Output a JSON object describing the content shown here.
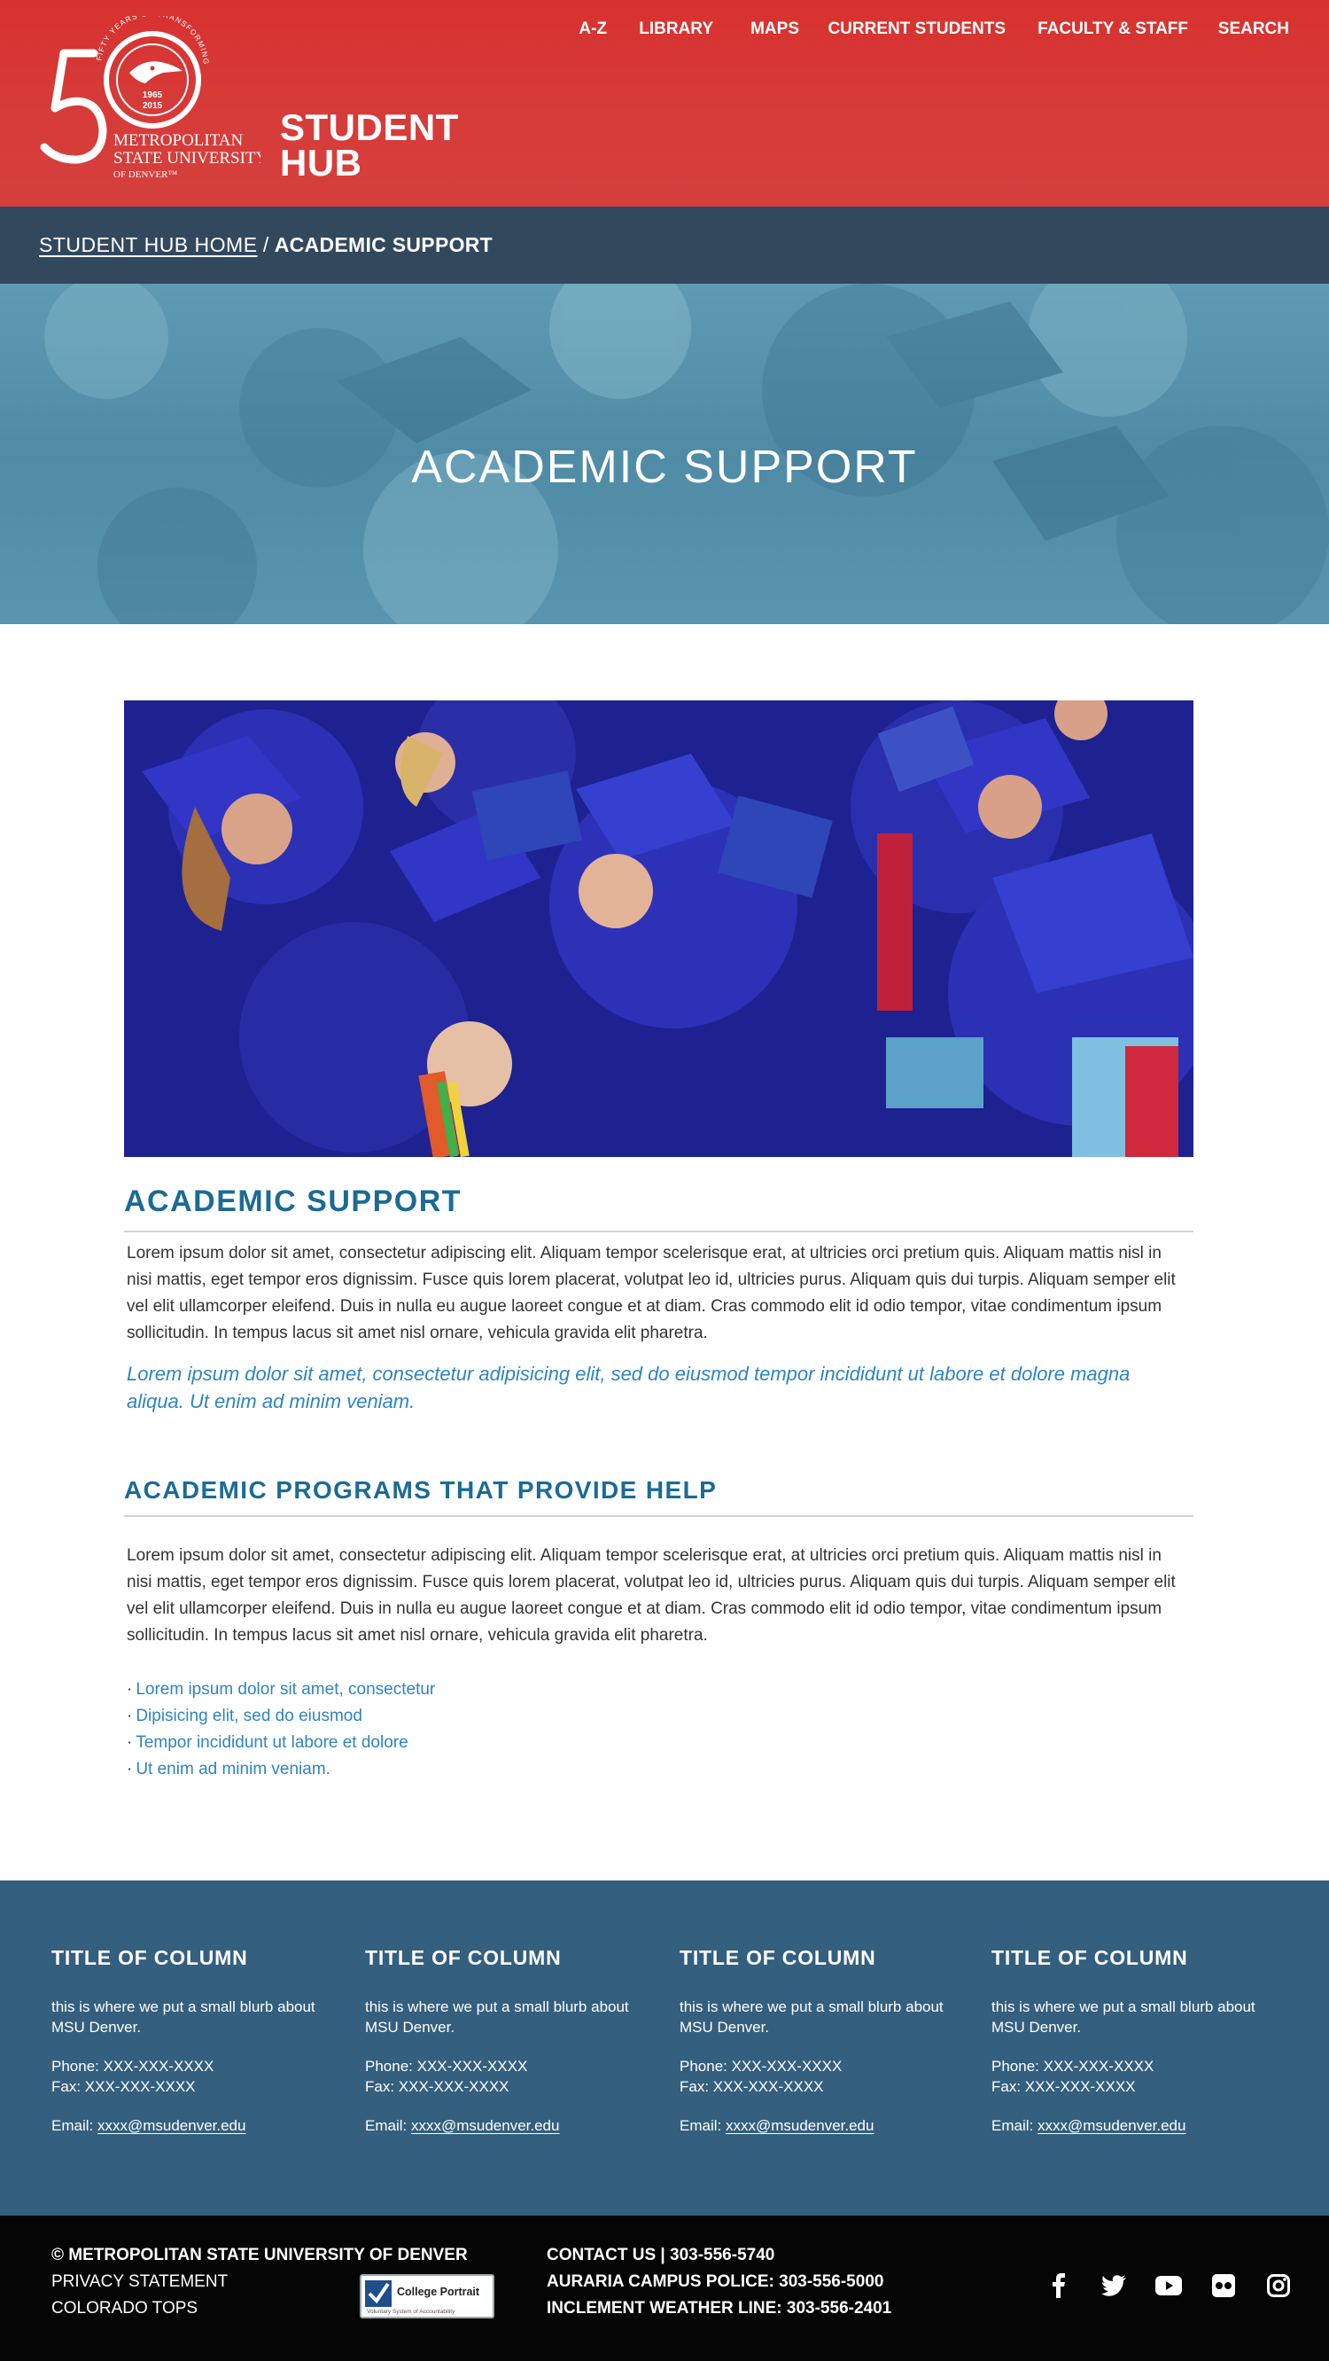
{
  "header": {
    "logo": {
      "numeral": "50",
      "ring_text": "FIFTY YEARS OF TRANSFORMING LIVES",
      "years_top": "1965",
      "years_bottom": "2015",
      "line1": "METROPOLITAN",
      "line2": "STATE UNIVERSITY",
      "line3": "OF DENVER™"
    },
    "hub_line1": "STUDENT",
    "hub_line2": "HUB",
    "nav": [
      "A-Z",
      "LIBRARY",
      "MAPS",
      "CURRENT STUDENTS",
      "FACULTY & STAFF",
      "SEARCH"
    ],
    "background_color": "#d7322f"
  },
  "breadcrumb": {
    "home": "STUDENT HUB HOME",
    "separator": " / ",
    "current": "ACADEMIC SUPPORT"
  },
  "hero": {
    "title": "ACADEMIC SUPPORT"
  },
  "main": {
    "section_title": "ACADEMIC SUPPORT",
    "paragraph1": "Lorem ipsum dolor sit amet, consectetur adipiscing elit. Aliquam tempor scelerisque erat, at ultricies orci pretium quis. Aliquam mattis nisl in nisi mattis, eget tempor eros dignissim. Fusce quis lorem placerat, volutpat leo id, ultricies purus. Aliquam quis dui turpis. Aliquam semper elit vel elit ullamcorper eleifend. Duis in nulla eu augue laoreet congue et at diam. Cras commodo elit id odio tempor, vitae condimentum ipsum sollicitudin. In tempus lacus sit amet nisl ornare, vehicula gravida elit pharetra.",
    "lead": "Lorem ipsum dolor sit amet, consectetur adipisicing elit, sed do eiusmod tempor incididunt ut labore et dolore magna aliqua. Ut enim ad minim veniam.",
    "programs_title": "ACADEMIC PROGRAMS THAT PROVIDE HELP",
    "paragraph2": "Lorem ipsum dolor sit amet, consectetur adipiscing elit. Aliquam tempor scelerisque erat, at ultricies orci pretium quis. Aliquam mattis nisl in nisi mattis, eget tempor eros dignissim. Fusce quis lorem placerat, volutpat leo id, ultricies purus. Aliquam quis dui turpis. Aliquam semper elit vel elit ullamcorper eleifend. Duis in nulla eu augue laoreet congue et at diam. Cras commodo elit id odio tempor, vitae condimentum ipsum sollicitudin. In tempus lacus sit amet nisl ornare, vehicula gravida elit pharetra.",
    "bullet_marker": "·",
    "links": [
      "Lorem ipsum dolor sit amet, consectetur",
      "Dipisicing elit, sed do eiusmod",
      "Tempor incididunt ut labore et dolore",
      "Ut enim ad minim veniam."
    ],
    "accent_color": "#1b6b96",
    "link_color": "#2e84c2"
  },
  "footer_columns": [
    {
      "title": "TITLE OF COLUMN",
      "blurb": "this is where we put a small blurb about MSU Denver.",
      "phone": "Phone: XXX-XXX-XXXX",
      "fax": "Fax: XXX-XXX-XXXX",
      "email_label": "Email: ",
      "email": "xxxx@msudenver.edu"
    },
    {
      "title": "TITLE OF COLUMN",
      "blurb": "this is where we put a small blurb about MSU Denver.",
      "phone": "Phone: XXX-XXX-XXXX",
      "fax": "Fax: XXX-XXX-XXXX",
      "email_label": "Email: ",
      "email": "xxxx@msudenver.edu"
    },
    {
      "title": "TITLE OF COLUMN",
      "blurb": "this is where we put a small blurb about MSU Denver.",
      "phone": "Phone: XXX-XXX-XXXX",
      "fax": "Fax: XXX-XXX-XXXX",
      "email_label": "Email: ",
      "email": "xxxx@msudenver.edu"
    },
    {
      "title": "TITLE OF COLUMN",
      "blurb": "this is where we put a small blurb about MSU Denver.",
      "phone": "Phone: XXX-XXX-XXXX",
      "fax": "Fax: XXX-XXX-XXXX",
      "email_label": "Email: ",
      "email": "xxxx@msudenver.edu"
    }
  ],
  "bottom_bar": {
    "copyright": "© METROPOLITAN STATE UNIVERSITY OF DENVER",
    "privacy": "PRIVACY STATEMENT",
    "tops": "COLORADO TOPS",
    "portrait_badge": {
      "title": "College Portrait",
      "subtitle": "Voluntary System of Accountability"
    },
    "contact": "CONTACT US | 303-556-5740",
    "police": "AURARIA CAMPUS POLICE: 303-556-5000",
    "weather": "INCLEMENT WEATHER LINE: 303-556-2401",
    "social_icons": [
      "facebook-icon",
      "twitter-icon",
      "youtube-icon",
      "flickr-icon",
      "instagram-icon"
    ]
  }
}
